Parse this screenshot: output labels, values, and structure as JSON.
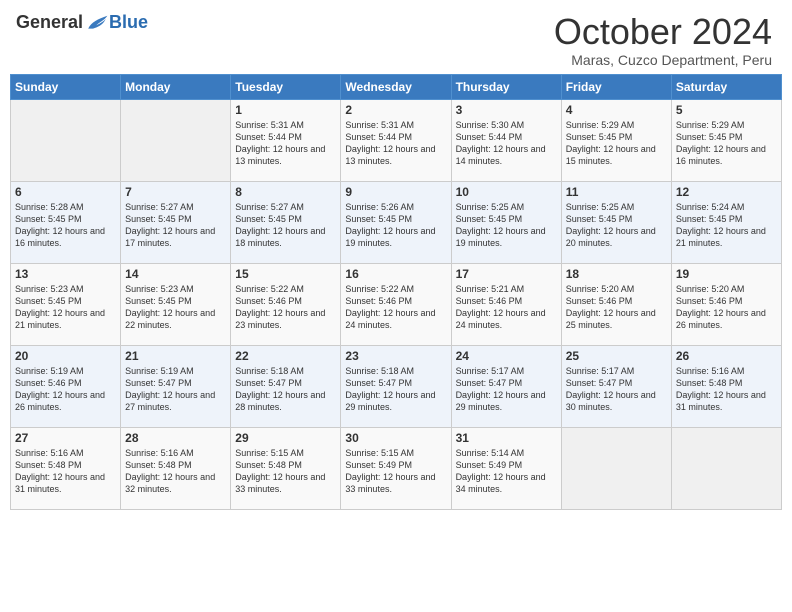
{
  "logo": {
    "general": "General",
    "blue": "Blue"
  },
  "title": "October 2024",
  "location": "Maras, Cuzco Department, Peru",
  "days_of_week": [
    "Sunday",
    "Monday",
    "Tuesday",
    "Wednesday",
    "Thursday",
    "Friday",
    "Saturday"
  ],
  "weeks": [
    [
      {
        "day": "",
        "empty": true
      },
      {
        "day": "",
        "empty": true
      },
      {
        "day": "1",
        "sunrise": "Sunrise: 5:31 AM",
        "sunset": "Sunset: 5:44 PM",
        "daylight": "Daylight: 12 hours and 13 minutes."
      },
      {
        "day": "2",
        "sunrise": "Sunrise: 5:31 AM",
        "sunset": "Sunset: 5:44 PM",
        "daylight": "Daylight: 12 hours and 13 minutes."
      },
      {
        "day": "3",
        "sunrise": "Sunrise: 5:30 AM",
        "sunset": "Sunset: 5:44 PM",
        "daylight": "Daylight: 12 hours and 14 minutes."
      },
      {
        "day": "4",
        "sunrise": "Sunrise: 5:29 AM",
        "sunset": "Sunset: 5:45 PM",
        "daylight": "Daylight: 12 hours and 15 minutes."
      },
      {
        "day": "5",
        "sunrise": "Sunrise: 5:29 AM",
        "sunset": "Sunset: 5:45 PM",
        "daylight": "Daylight: 12 hours and 16 minutes."
      }
    ],
    [
      {
        "day": "6",
        "sunrise": "Sunrise: 5:28 AM",
        "sunset": "Sunset: 5:45 PM",
        "daylight": "Daylight: 12 hours and 16 minutes."
      },
      {
        "day": "7",
        "sunrise": "Sunrise: 5:27 AM",
        "sunset": "Sunset: 5:45 PM",
        "daylight": "Daylight: 12 hours and 17 minutes."
      },
      {
        "day": "8",
        "sunrise": "Sunrise: 5:27 AM",
        "sunset": "Sunset: 5:45 PM",
        "daylight": "Daylight: 12 hours and 18 minutes."
      },
      {
        "day": "9",
        "sunrise": "Sunrise: 5:26 AM",
        "sunset": "Sunset: 5:45 PM",
        "daylight": "Daylight: 12 hours and 19 minutes."
      },
      {
        "day": "10",
        "sunrise": "Sunrise: 5:25 AM",
        "sunset": "Sunset: 5:45 PM",
        "daylight": "Daylight: 12 hours and 19 minutes."
      },
      {
        "day": "11",
        "sunrise": "Sunrise: 5:25 AM",
        "sunset": "Sunset: 5:45 PM",
        "daylight": "Daylight: 12 hours and 20 minutes."
      },
      {
        "day": "12",
        "sunrise": "Sunrise: 5:24 AM",
        "sunset": "Sunset: 5:45 PM",
        "daylight": "Daylight: 12 hours and 21 minutes."
      }
    ],
    [
      {
        "day": "13",
        "sunrise": "Sunrise: 5:23 AM",
        "sunset": "Sunset: 5:45 PM",
        "daylight": "Daylight: 12 hours and 21 minutes."
      },
      {
        "day": "14",
        "sunrise": "Sunrise: 5:23 AM",
        "sunset": "Sunset: 5:45 PM",
        "daylight": "Daylight: 12 hours and 22 minutes."
      },
      {
        "day": "15",
        "sunrise": "Sunrise: 5:22 AM",
        "sunset": "Sunset: 5:46 PM",
        "daylight": "Daylight: 12 hours and 23 minutes."
      },
      {
        "day": "16",
        "sunrise": "Sunrise: 5:22 AM",
        "sunset": "Sunset: 5:46 PM",
        "daylight": "Daylight: 12 hours and 24 minutes."
      },
      {
        "day": "17",
        "sunrise": "Sunrise: 5:21 AM",
        "sunset": "Sunset: 5:46 PM",
        "daylight": "Daylight: 12 hours and 24 minutes."
      },
      {
        "day": "18",
        "sunrise": "Sunrise: 5:20 AM",
        "sunset": "Sunset: 5:46 PM",
        "daylight": "Daylight: 12 hours and 25 minutes."
      },
      {
        "day": "19",
        "sunrise": "Sunrise: 5:20 AM",
        "sunset": "Sunset: 5:46 PM",
        "daylight": "Daylight: 12 hours and 26 minutes."
      }
    ],
    [
      {
        "day": "20",
        "sunrise": "Sunrise: 5:19 AM",
        "sunset": "Sunset: 5:46 PM",
        "daylight": "Daylight: 12 hours and 26 minutes."
      },
      {
        "day": "21",
        "sunrise": "Sunrise: 5:19 AM",
        "sunset": "Sunset: 5:47 PM",
        "daylight": "Daylight: 12 hours and 27 minutes."
      },
      {
        "day": "22",
        "sunrise": "Sunrise: 5:18 AM",
        "sunset": "Sunset: 5:47 PM",
        "daylight": "Daylight: 12 hours and 28 minutes."
      },
      {
        "day": "23",
        "sunrise": "Sunrise: 5:18 AM",
        "sunset": "Sunset: 5:47 PM",
        "daylight": "Daylight: 12 hours and 29 minutes."
      },
      {
        "day": "24",
        "sunrise": "Sunrise: 5:17 AM",
        "sunset": "Sunset: 5:47 PM",
        "daylight": "Daylight: 12 hours and 29 minutes."
      },
      {
        "day": "25",
        "sunrise": "Sunrise: 5:17 AM",
        "sunset": "Sunset: 5:47 PM",
        "daylight": "Daylight: 12 hours and 30 minutes."
      },
      {
        "day": "26",
        "sunrise": "Sunrise: 5:16 AM",
        "sunset": "Sunset: 5:48 PM",
        "daylight": "Daylight: 12 hours and 31 minutes."
      }
    ],
    [
      {
        "day": "27",
        "sunrise": "Sunrise: 5:16 AM",
        "sunset": "Sunset: 5:48 PM",
        "daylight": "Daylight: 12 hours and 31 minutes."
      },
      {
        "day": "28",
        "sunrise": "Sunrise: 5:16 AM",
        "sunset": "Sunset: 5:48 PM",
        "daylight": "Daylight: 12 hours and 32 minutes."
      },
      {
        "day": "29",
        "sunrise": "Sunrise: 5:15 AM",
        "sunset": "Sunset: 5:48 PM",
        "daylight": "Daylight: 12 hours and 33 minutes."
      },
      {
        "day": "30",
        "sunrise": "Sunrise: 5:15 AM",
        "sunset": "Sunset: 5:49 PM",
        "daylight": "Daylight: 12 hours and 33 minutes."
      },
      {
        "day": "31",
        "sunrise": "Sunrise: 5:14 AM",
        "sunset": "Sunset: 5:49 PM",
        "daylight": "Daylight: 12 hours and 34 minutes."
      },
      {
        "day": "",
        "empty": true
      },
      {
        "day": "",
        "empty": true
      }
    ]
  ]
}
